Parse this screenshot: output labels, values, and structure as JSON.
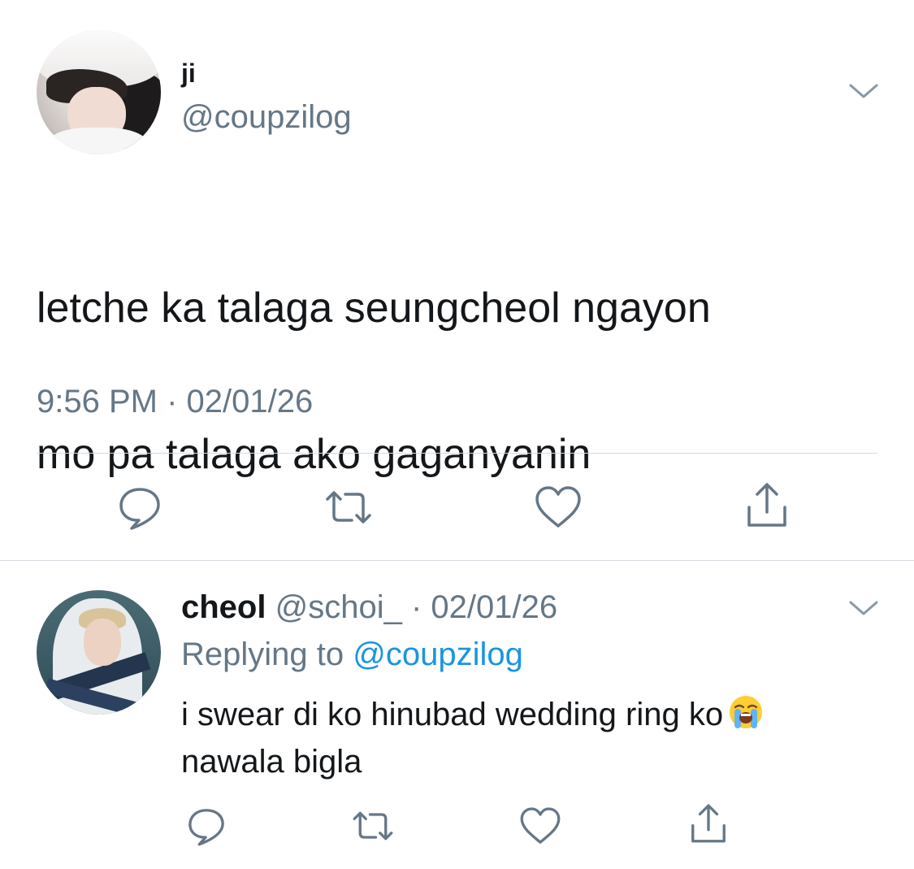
{
  "main_tweet": {
    "display_name": "ji",
    "handle": "@coupzilog",
    "text_line1": "letche ka talaga seungcheol ngayon",
    "text_line2": "mo pa talaga ako gaganyanin",
    "time": "9:56 PM",
    "separator": " · ",
    "date": "02/01/26",
    "icons": {
      "menu": "chevron-down-icon",
      "reply": "reply-icon",
      "retweet": "retweet-icon",
      "like": "heart-icon",
      "share": "share-icon"
    }
  },
  "reply_tweet": {
    "display_name": "cheol",
    "handle": "@schoi_",
    "separator": " · ",
    "date": "02/01/26",
    "replying_label": "Replying to ",
    "replying_to": "@coupzilog",
    "text_line1": "i swear di ko hinubad wedding ring ko",
    "text_line2": "nawala bigla",
    "emoji": "loudly-crying-face-emoji",
    "icons": {
      "menu": "chevron-down-icon",
      "reply": "reply-icon",
      "retweet": "retweet-icon",
      "like": "heart-icon",
      "share": "share-icon"
    }
  },
  "colors": {
    "text": "#14171a",
    "secondary": "#657786",
    "link": "#1b95e0",
    "divider": "#d5dadf"
  }
}
